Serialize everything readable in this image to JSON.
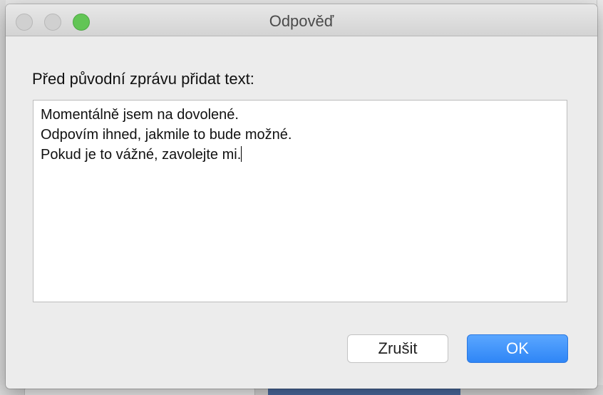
{
  "window": {
    "title": "Odpověď"
  },
  "prompt": {
    "label": "Před původní zprávu přidat text:"
  },
  "message": {
    "lines": [
      "Momentálně jsem na dovolené.",
      "Odpovím ihned, jakmile to bude možné.",
      "Pokud je to vážné, zavolejte mi."
    ]
  },
  "buttons": {
    "cancel": "Zrušit",
    "ok": "OK"
  },
  "colors": {
    "accent": "#2f86f6",
    "zoom": "#62c555"
  }
}
